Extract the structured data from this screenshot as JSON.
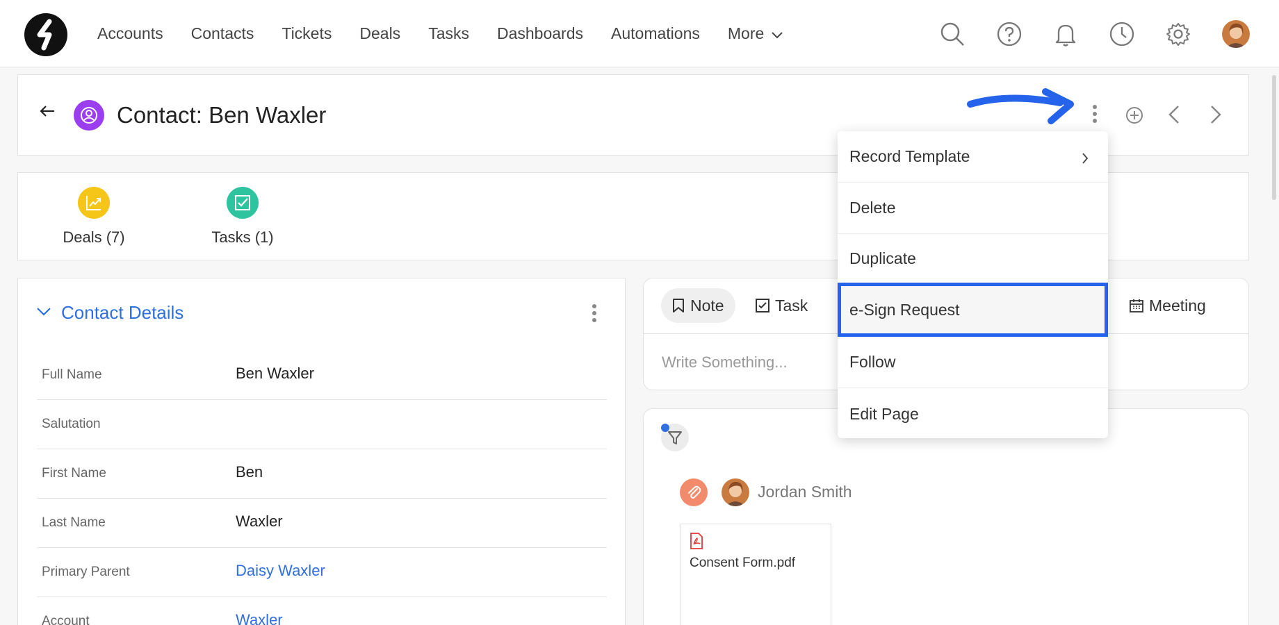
{
  "nav": {
    "items": [
      "Accounts",
      "Contacts",
      "Tickets",
      "Deals",
      "Tasks",
      "Dashboards",
      "Automations"
    ],
    "more_label": "More",
    "icons": [
      "search-icon",
      "help-icon",
      "bell-icon",
      "clock-icon",
      "gear-icon",
      "avatar"
    ]
  },
  "record": {
    "title": "Contact: Ben Waxler"
  },
  "related": {
    "items": [
      {
        "label": "Deals (7)",
        "icon": "chart-icon",
        "color": "#f5c518"
      },
      {
        "label": "Tasks (1)",
        "icon": "check-icon",
        "color": "#2ec4a0"
      }
    ]
  },
  "details": {
    "title": "Contact Details",
    "fields": [
      {
        "label": "Full Name",
        "value": "Ben Waxler",
        "link": false
      },
      {
        "label": "Salutation",
        "value": "",
        "link": false
      },
      {
        "label": "First Name",
        "value": "Ben",
        "link": false
      },
      {
        "label": "Last Name",
        "value": "Waxler",
        "link": false
      },
      {
        "label": "Primary Parent",
        "value": "Daisy Waxler",
        "link": true
      },
      {
        "label": "Account",
        "value": "Waxler",
        "link": true
      }
    ]
  },
  "composer": {
    "tabs": [
      "Note",
      "Task",
      "Meeting"
    ],
    "placeholder": "Write Something..."
  },
  "timeline": {
    "user": "Jordan Smith",
    "file_name": "Consent Form.pdf"
  },
  "menu": {
    "items": [
      {
        "label": "Record Template",
        "submenu": true,
        "highlight": false
      },
      {
        "label": "Delete",
        "submenu": false,
        "highlight": false
      },
      {
        "label": "Duplicate",
        "submenu": false,
        "highlight": false
      },
      {
        "label": "e-Sign Request",
        "submenu": false,
        "highlight": true
      },
      {
        "label": "Follow",
        "submenu": false,
        "highlight": false
      },
      {
        "label": "Edit Page",
        "submenu": false,
        "highlight": false
      }
    ]
  },
  "colors": {
    "accent_blue": "#2f6fde",
    "highlight_border": "#2563eb",
    "contact_badge": "#9b3ef0"
  }
}
